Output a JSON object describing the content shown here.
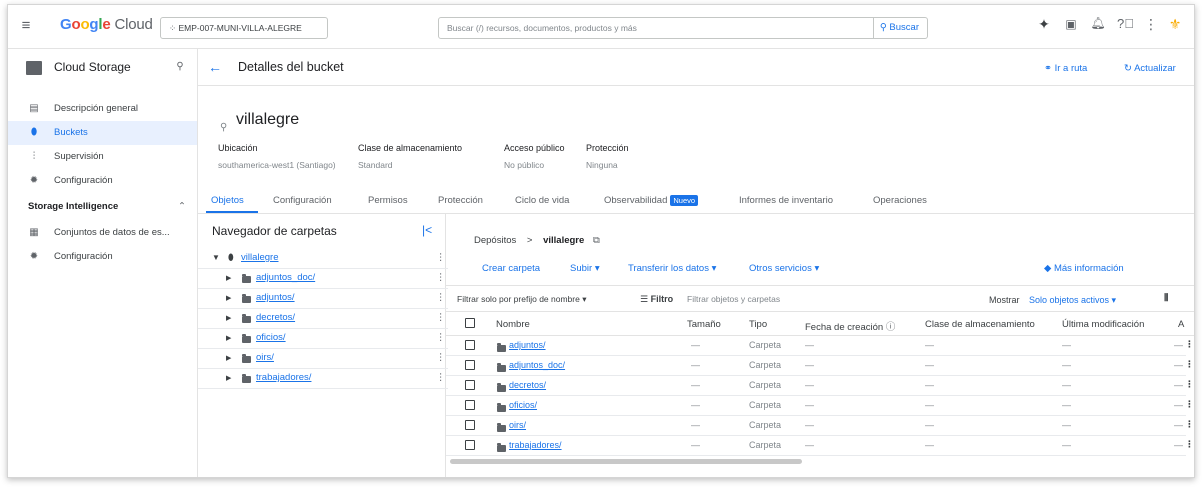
{
  "topbar": {
    "logo_google": "Google",
    "logo_cloud": "Cloud",
    "project": "EMP-007-MUNI-VILLA-ALEGRE",
    "search_placeholder": "Buscar (/) recursos, documentos, productos y más",
    "search_button": "Buscar"
  },
  "sidebar": {
    "title": "Cloud Storage",
    "items": [
      {
        "label": "Descripción general",
        "icon": "overview-icon"
      },
      {
        "label": "Buckets",
        "icon": "bucket-icon"
      },
      {
        "label": "Supervisión",
        "icon": "monitoring-icon"
      },
      {
        "label": "Configuración",
        "icon": "gear-icon"
      }
    ],
    "section": "Storage Intelligence",
    "section_items": [
      {
        "label": "Conjuntos de datos de es...",
        "icon": "dataset-icon"
      },
      {
        "label": "Configuración",
        "icon": "gear-icon"
      }
    ]
  },
  "header": {
    "title": "Detalles del bucket",
    "goto": "Ir a ruta",
    "refresh": "Actualizar"
  },
  "bucket": {
    "name": "villalegre",
    "props": [
      {
        "label": "Ubicación",
        "value": "southamerica-west1 (Santiago)"
      },
      {
        "label": "Clase de almacenamiento",
        "value": "Standard"
      },
      {
        "label": "Acceso público",
        "value": "No público"
      },
      {
        "label": "Protección",
        "value": "Ninguna"
      }
    ]
  },
  "tabs": [
    "Objetos",
    "Configuración",
    "Permisos",
    "Protección",
    "Ciclo de vida",
    "Observabilidad",
    "Informes de inventario",
    "Operaciones"
  ],
  "new_badge": "Nuevo",
  "tree": {
    "title": "Navegador de carpetas",
    "root": "villalegre",
    "folders": [
      "adjuntos_doc/",
      "adjuntos/",
      "decretos/",
      "oficios/",
      "oirs/",
      "trabajadores/"
    ]
  },
  "content": {
    "breadcrumb_root": "Depósitos",
    "breadcrumb_sep": ">",
    "breadcrumb_current": "villalegre",
    "actions": [
      "Crear carpeta",
      "Subir",
      "Transferir los datos",
      "Otros servicios"
    ],
    "more_info": "Más información",
    "filter_prefix": "Filtrar solo por prefijo de nombre",
    "filter_label": "Filtro",
    "filter_placeholder": "Filtrar objetos y carpetas",
    "show_label": "Mostrar",
    "show_value": "Solo objetos activos",
    "columns": [
      "Nombre",
      "Tamaño",
      "Tipo",
      "Fecha de creación",
      "Clase de almacenamiento",
      "Última modificación",
      "A"
    ],
    "rows": [
      {
        "name": "adjuntos/",
        "size": "—",
        "type": "Carpeta",
        "created": "—",
        "class": "—",
        "modified": "—",
        "a": "—"
      },
      {
        "name": "adjuntos_doc/",
        "size": "—",
        "type": "Carpeta",
        "created": "—",
        "class": "—",
        "modified": "—",
        "a": "—"
      },
      {
        "name": "decretos/",
        "size": "—",
        "type": "Carpeta",
        "created": "—",
        "class": "—",
        "modified": "—",
        "a": "—"
      },
      {
        "name": "oficios/",
        "size": "—",
        "type": "Carpeta",
        "created": "—",
        "class": "—",
        "modified": "—",
        "a": "—"
      },
      {
        "name": "oirs/",
        "size": "—",
        "type": "Carpeta",
        "created": "—",
        "class": "—",
        "modified": "—",
        "a": "—"
      },
      {
        "name": "trabajadores/",
        "size": "—",
        "type": "Carpeta",
        "created": "—",
        "class": "—",
        "modified": "—",
        "a": "—"
      }
    ]
  },
  "colors": {
    "accent": "#1a73e8",
    "text": "#3c4043",
    "muted": "#80868b",
    "active_bg": "#e8f0fe"
  }
}
